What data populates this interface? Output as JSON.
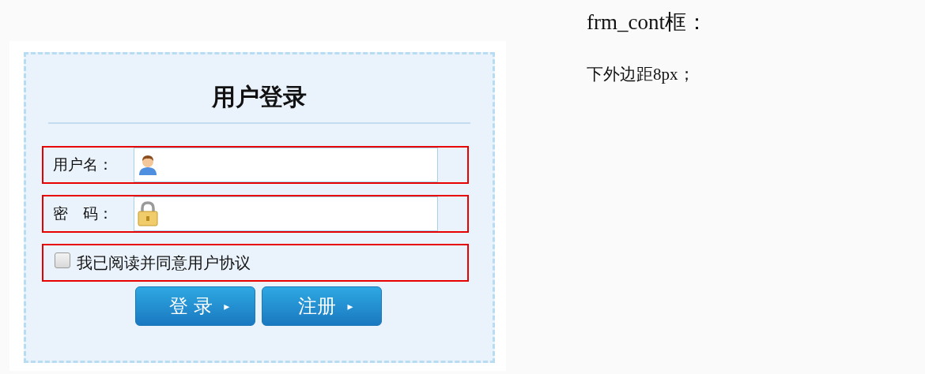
{
  "login_form": {
    "title": "用户登录",
    "fields": [
      {
        "kind": "username",
        "label": "用户名："
      },
      {
        "kind": "password",
        "label": "密　码："
      }
    ],
    "agreement": {
      "label": "我已阅读并同意用户协议",
      "checked": false
    },
    "buttons": [
      {
        "label": "登 录",
        "arrow": "▸"
      },
      {
        "label": "注册",
        "arrow": "▸"
      }
    ]
  },
  "notes": {
    "heading": "frm_cont框：",
    "text": "下外边距8px；"
  }
}
